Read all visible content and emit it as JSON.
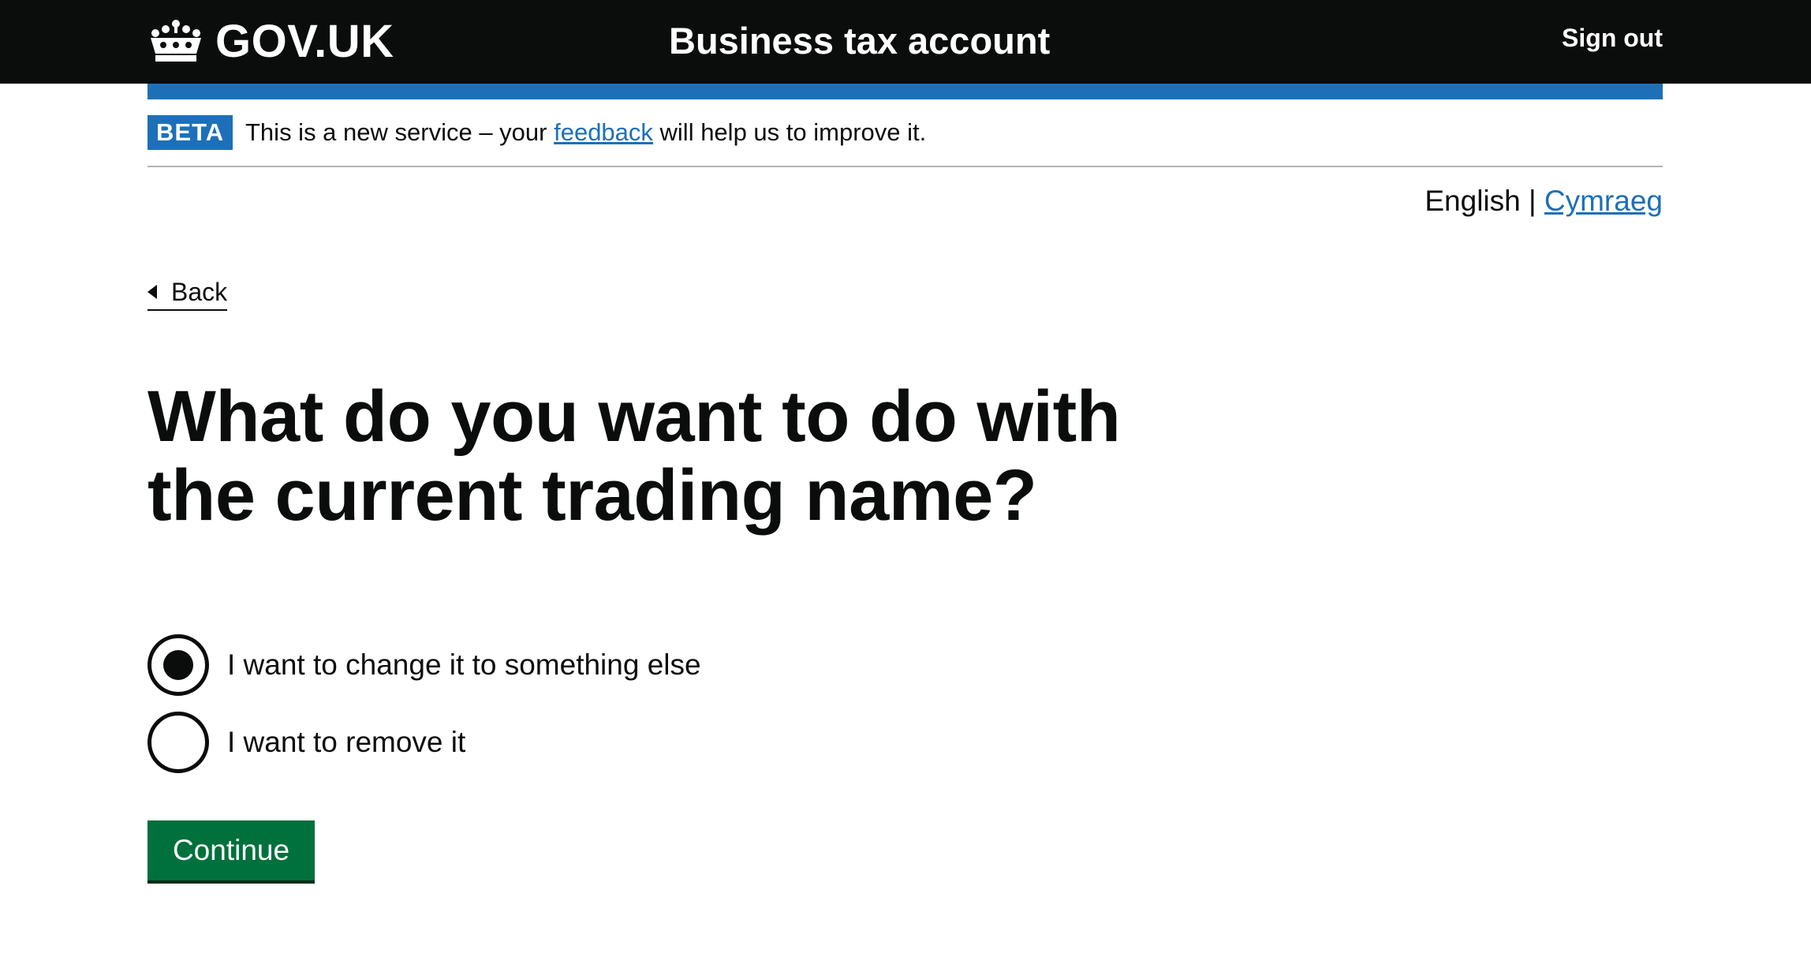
{
  "header": {
    "logo_text": "GOV.UK",
    "service_name": "Business tax account",
    "sign_out": "Sign out"
  },
  "phase_banner": {
    "tag": "BETA",
    "text_before": "This is a new service – your ",
    "link": "feedback",
    "text_after": " will help us to improve it."
  },
  "language": {
    "current": "English",
    "separator": " | ",
    "other": "Cymraeg"
  },
  "back_link": "Back",
  "question": {
    "title": "What do you want to do with the current trading name?",
    "options": [
      {
        "label": "I want to change it to something else",
        "selected": true
      },
      {
        "label": "I want to remove it",
        "selected": false
      }
    ]
  },
  "continue_button": "Continue",
  "colors": {
    "header_bg": "#0b0c0c",
    "brand_blue": "#1d70b8",
    "button_green": "#00703c",
    "text": "#0b0c0c"
  },
  "icons": [
    "crown-icon",
    "back-arrow-icon"
  ]
}
